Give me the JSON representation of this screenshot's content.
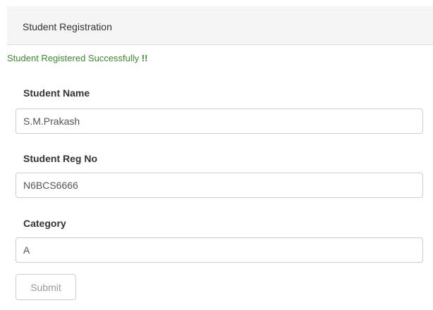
{
  "panel": {
    "title": "Student Registration"
  },
  "alert": {
    "message": "Student Registered Successfully ",
    "emphasis": "!!",
    "color": "#3c8a2e"
  },
  "form": {
    "student_name": {
      "label": "Student Name",
      "value": "S.M.Prakash"
    },
    "student_reg_no": {
      "label": "Student Reg No",
      "value": "N6BCS6666"
    },
    "category": {
      "label": "Category",
      "value": "A"
    },
    "submit_label": "Submit"
  }
}
